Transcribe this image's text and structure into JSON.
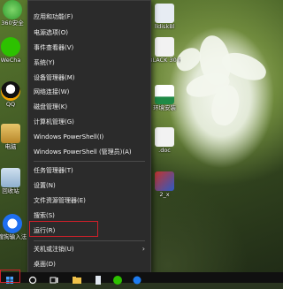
{
  "desktop": {
    "icons": [
      {
        "label": "360安全"
      },
      {
        "label": "WeCha"
      },
      {
        "label": "QQ"
      },
      {
        "label": "电脑"
      },
      {
        "label": "回收站"
      },
      {
        "label": "搜狗输入法"
      }
    ],
    "right_icons": [
      {
        "label": "lldiskBl"
      },
      {
        "label": "BLACK 30 N"
      },
      {
        "label": "环境安装"
      },
      {
        "label": ".doc"
      },
      {
        "label": "2_x"
      }
    ]
  },
  "context_menu": {
    "items": [
      {
        "label": "应用和功能(F)"
      },
      {
        "label": "电源选项(O)"
      },
      {
        "label": "事件查看器(V)"
      },
      {
        "label": "系统(Y)"
      },
      {
        "label": "设备管理器(M)"
      },
      {
        "label": "网络连接(W)"
      },
      {
        "label": "磁盘管理(K)"
      },
      {
        "label": "计算机管理(G)"
      },
      {
        "label": "Windows PowerShell(I)"
      },
      {
        "label": "Windows PowerShell (管理员)(A)"
      },
      {
        "label": "任务管理器(T)"
      },
      {
        "label": "设置(N)"
      },
      {
        "label": "文件资源管理器(E)"
      },
      {
        "label": "搜索(S)"
      },
      {
        "label": "运行(R)"
      },
      {
        "label": "关机或注销(U)"
      },
      {
        "label": "桌面(D)"
      }
    ],
    "submenu_arrow": "›",
    "highlighted": "运行(R)"
  },
  "taskbar": {
    "items": [
      {
        "icon": "windows-start-icon"
      },
      {
        "icon": "search-circle-icon"
      },
      {
        "icon": "task-view-icon"
      },
      {
        "icon": "explorer-icon"
      },
      {
        "icon": "file-icon"
      },
      {
        "icon": "wechat-icon"
      },
      {
        "icon": "app-icon"
      }
    ]
  },
  "colors": {
    "menu_bg": "#2b2b2b",
    "menu_text": "#f2f2f2",
    "highlight_border": "#d0202a",
    "taskbar_bg": "#101010"
  }
}
